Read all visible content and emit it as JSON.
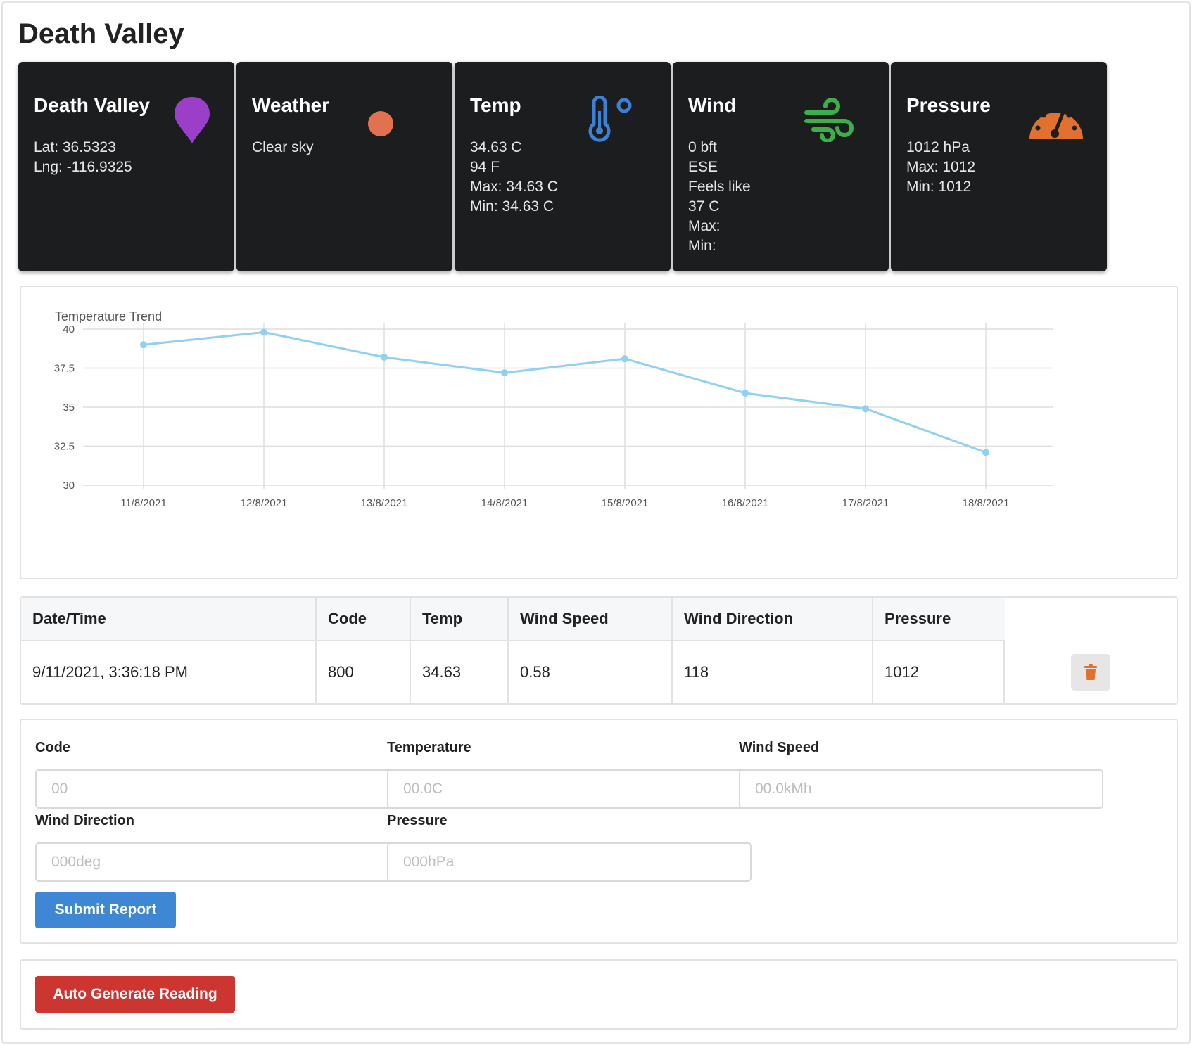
{
  "page": {
    "title": "Death Valley"
  },
  "cards": {
    "location": {
      "title": "Death Valley",
      "lines": [
        "Lat: 36.5323",
        "Lng: -116.9325"
      ],
      "icon": "map-pin-icon",
      "icon_color": "#9b3fc8"
    },
    "weather": {
      "title": "Weather",
      "lines": [
        "Clear sky"
      ],
      "icon": "sun-icon",
      "icon_color": "#e2714f"
    },
    "temp": {
      "title": "Temp",
      "lines": [
        "34.63 C",
        "94 F",
        "Max: 34.63 C",
        "Min: 34.63 C"
      ],
      "icon": "thermometer-icon",
      "icon_color": "#3b82d6"
    },
    "wind": {
      "title": "Wind",
      "lines": [
        "0 bft",
        "ESE",
        "Feels like",
        "37 C",
        "Max:",
        "Min:"
      ],
      "icon": "wind-icon",
      "icon_color": "#3dae4a"
    },
    "pressure": {
      "title": "Pressure",
      "lines": [
        "1012 hPa",
        "Max: 1012",
        "Min: 1012"
      ],
      "icon": "gauge-icon",
      "icon_color": "#e2702f"
    }
  },
  "chart_data": {
    "type": "line",
    "title": "Temperature Trend",
    "categories": [
      "11/8/2021",
      "12/8/2021",
      "13/8/2021",
      "14/8/2021",
      "15/8/2021",
      "16/8/2021",
      "17/8/2021",
      "18/8/2021"
    ],
    "series": [
      {
        "values": [
          39.0,
          39.8,
          38.2,
          37.2,
          38.1,
          35.9,
          34.9,
          32.1
        ],
        "color": "#8fd0f3"
      }
    ],
    "ylim": [
      30,
      40
    ],
    "yticks": [
      "40",
      "37.5",
      "35",
      "32.5",
      "30"
    ],
    "grid": true,
    "legend": "none"
  },
  "table": {
    "headers": [
      "Date/Time",
      "Code",
      "Temp",
      "Wind Speed",
      "Wind Direction",
      "Pressure"
    ],
    "rows": [
      {
        "cells": [
          "9/11/2021, 3:36:18 PM",
          "800",
          "34.63",
          "0.58",
          "118",
          "1012"
        ]
      }
    ],
    "delete_icon": "trash-icon",
    "delete_color": "#e2702f"
  },
  "form": {
    "code": {
      "label": "Code",
      "placeholder": "00",
      "value": ""
    },
    "temperature": {
      "label": "Temperature",
      "placeholder": "00.0C",
      "value": ""
    },
    "wind_speed": {
      "label": "Wind Speed",
      "placeholder": "00.0kMh",
      "value": ""
    },
    "wind_direction": {
      "label": "Wind Direction",
      "placeholder": "000deg",
      "value": ""
    },
    "pressure": {
      "label": "Pressure",
      "placeholder": "000hPa",
      "value": ""
    },
    "submit_label": "Submit Report"
  },
  "auto": {
    "button_label": "Auto Generate Reading"
  },
  "colors": {
    "card_bg": "#1c1d1f",
    "submit": "#3d87d4",
    "auto": "#cd3530"
  }
}
